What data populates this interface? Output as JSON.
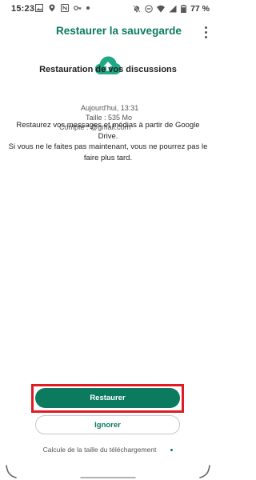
{
  "status_bar": {
    "time": "15:23",
    "battery": "77 %"
  },
  "app_bar": {
    "title": "Restaurer la sauvegarde",
    "menu_icon": "more-vert-icon"
  },
  "content": {
    "cloud_icon": "cloud-upload-icon",
    "title": "Restauration de vos discussions",
    "date": "Aujourd'hui, 13:31",
    "size": "Taille : 535 Mo",
    "account": "Compte : @gmail.com",
    "description_lines": [
      "Restaurez vos messages et médias à partir de Google Drive.",
      "Si vous ne le faites pas maintenant, vous ne pourrez pas le",
      "faire plus tard."
    ]
  },
  "actions": {
    "restore_label": "Restaurer",
    "ignore_label": "Ignorer",
    "calc_label": "Calcule de la taille du téléchargement"
  },
  "colors": {
    "accent": "#0b7a5f",
    "highlight": "#e01b24"
  }
}
